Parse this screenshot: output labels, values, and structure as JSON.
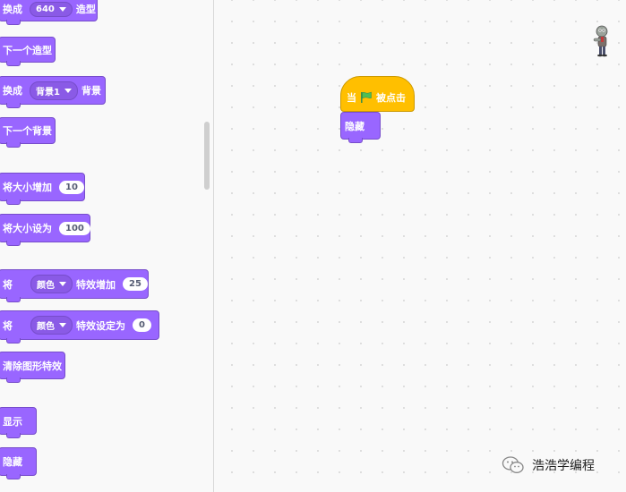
{
  "palette": {
    "switch_costume": {
      "prefix": "换成",
      "value": "640",
      "suffix": "造型"
    },
    "next_costume": "下一个造型",
    "switch_backdrop": {
      "prefix": "换成",
      "value": "背景1",
      "suffix": "背景"
    },
    "next_backdrop": "下一个背景",
    "change_size": {
      "label": "将大小增加",
      "value": "10"
    },
    "set_size": {
      "label": "将大小设为",
      "value": "100"
    },
    "change_effect": {
      "prefix": "将",
      "effect": "颜色",
      "label": "特效增加",
      "value": "25"
    },
    "set_effect": {
      "prefix": "将",
      "effect": "颜色",
      "label": "特效设定为",
      "value": "0"
    },
    "clear_effects": "清除图形特效",
    "show": "显示",
    "hide": "隐藏"
  },
  "workspace": {
    "hat": {
      "prefix": "当",
      "flag_icon": "green-flag-icon",
      "suffix": "被点击"
    },
    "hide_block": "隐藏"
  },
  "watermark": {
    "text": "浩浩学编程"
  },
  "colors": {
    "looks": "#9966ff",
    "events": "#ffbf00",
    "flag": "#4cbf56"
  }
}
